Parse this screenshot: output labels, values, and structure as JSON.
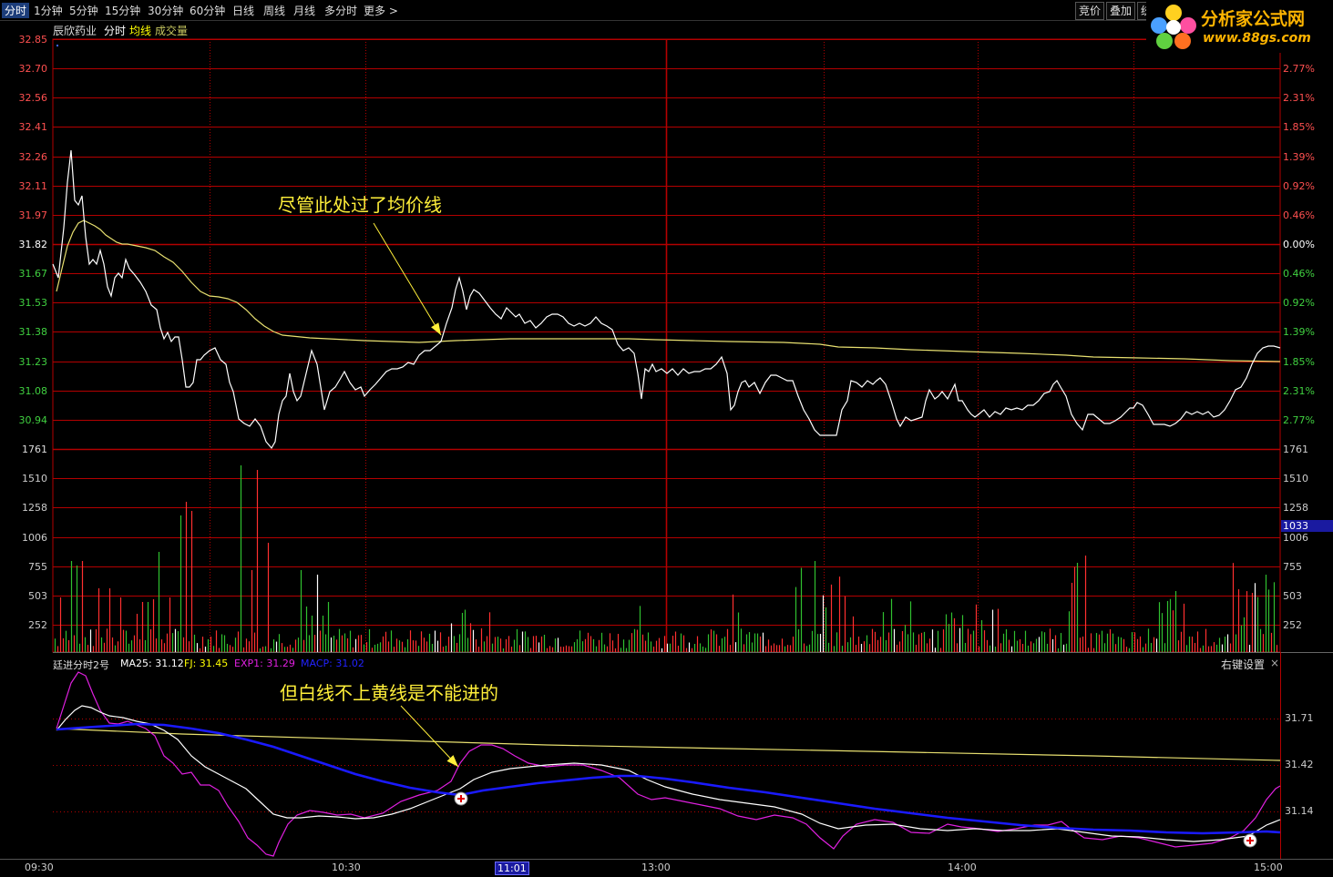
{
  "toolbar": {
    "tabs": [
      "分时",
      "1分钟",
      "5分钟",
      "15分钟",
      "30分钟",
      "60分钟",
      "日线",
      "周线",
      "月线",
      "多分时",
      "更多 >"
    ],
    "right_buttons": [
      "竞价",
      "叠加",
      "统"
    ]
  },
  "logo": {
    "text1": "分析家公式网",
    "text2": "www.88gs.com"
  },
  "header": {
    "stock": "辰欣药业",
    "mode": "分时",
    "avg": "均线",
    "vol": "成交量"
  },
  "price_axis": [
    "32.85",
    "32.70",
    "32.56",
    "32.41",
    "32.26",
    "32.11",
    "31.97",
    "31.82",
    "31.67",
    "31.53",
    "31.38",
    "31.23",
    "31.08",
    "30.94",
    "1761"
  ],
  "pct_axis": [
    "2.77%",
    "2.31%",
    "1.85%",
    "1.39%",
    "0.92%",
    "0.46%",
    "0.00%",
    "0.46%",
    "0.92%",
    "1.39%",
    "1.85%",
    "2.31%",
    "2.77%"
  ],
  "vol_axis_left": [
    "1510",
    "1258",
    "1006",
    "755",
    "503",
    "252"
  ],
  "vol_axis_right": [
    "1761",
    "1510",
    "1258",
    "1006",
    "755",
    "503",
    "252"
  ],
  "vol_marker": "1033",
  "indicator": {
    "name": "廷进分时2号",
    "ma25": "MA25: 31.12",
    "fj": "FJ: 31.45",
    "exp1": "EXP1: 31.29",
    "macp": "MACP: 31.02",
    "settings": "右键设置",
    "close": "×",
    "axis": [
      "31.71",
      "31.42",
      "31.14"
    ]
  },
  "time_axis": [
    "09:30",
    "10:30",
    "11:01",
    "13:00",
    "14:00",
    "15:00"
  ],
  "annotations": {
    "top": "尽管此处过了均价线",
    "bottom": "但白线不上黄线是不能进的"
  },
  "colors": {
    "grid_red": "#b40000",
    "price_white": "#ffffff",
    "avg_yellow": "#e8e070",
    "vol_red": "#ff3030",
    "vol_green": "#30c030",
    "exp_magenta": "#e020e0",
    "ma_blue": "#1a1aff",
    "annotation": "#ffef3a"
  }
}
